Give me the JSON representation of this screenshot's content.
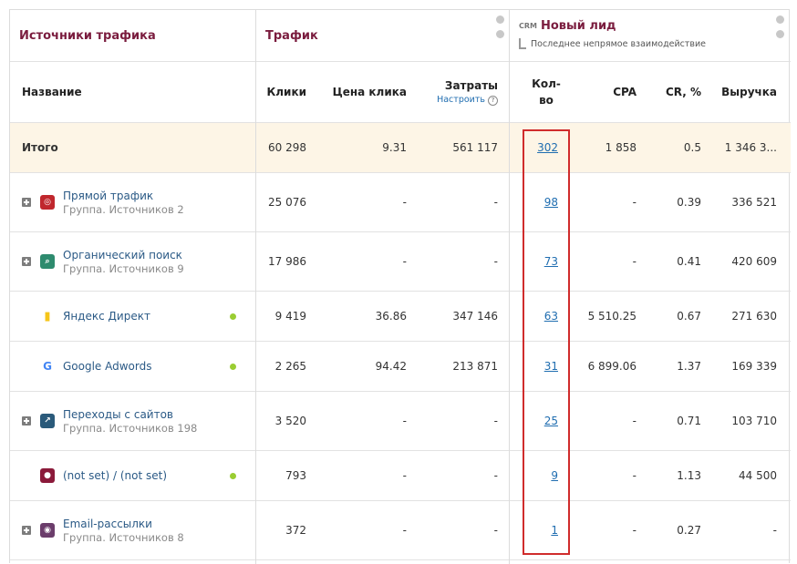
{
  "header": {
    "sources_title": "Источники трафика",
    "traffic_title": "Трафик",
    "crm_badge": "CRM",
    "lead_title": "Новый лид",
    "lead_subtitle": "Последнее непрямое взаимодействие"
  },
  "columns": {
    "name": "Название",
    "clicks": "Клики",
    "click_price": "Цена клика",
    "costs": "Затраты",
    "costs_setup": "Настроить",
    "qty_line1": "Кол-",
    "qty_line2": "во",
    "cpa": "CPA",
    "cr": "CR, %",
    "revenue": "Выручка"
  },
  "total": {
    "label": "Итого",
    "clicks": "60 298",
    "price": "9.31",
    "costs": "561 117",
    "qty": "302",
    "cpa": "1 858",
    "cr": "0.5",
    "revenue": "1 346 3..."
  },
  "rows": [
    {
      "name": "Прямой трафик",
      "sub": "Группа. Источников 2",
      "clicks": "25 076",
      "price": "-",
      "costs": "-",
      "qty": "98",
      "cpa": "-",
      "cr": "0.39",
      "revenue": "336 521",
      "icon": "direct-traffic-icon",
      "color": "#c0272d"
    },
    {
      "name": "Органический поиск",
      "sub": "Группа. Источников 9",
      "clicks": "17 986",
      "price": "-",
      "costs": "-",
      "qty": "73",
      "cpa": "-",
      "cr": "0.41",
      "revenue": "420 609",
      "icon": "search-icon",
      "color": "#2e8b6e"
    },
    {
      "name": "Яндекс Директ",
      "sub": "",
      "clicks": "9 419",
      "price": "36.86",
      "costs": "347 146",
      "qty": "63",
      "cpa": "5 510.25",
      "cr": "0.67",
      "revenue": "271 630",
      "icon": "yandex-direct-icon",
      "color": "#f5c518"
    },
    {
      "name": "Google Adwords",
      "sub": "",
      "clicks": "2 265",
      "price": "94.42",
      "costs": "213 871",
      "qty": "31",
      "cpa": "6 899.06",
      "cr": "1.37",
      "revenue": "169 339",
      "icon": "google-icon",
      "color": "#4285f4"
    },
    {
      "name": "Переходы с сайтов",
      "sub": "Группа. Источников 198",
      "clicks": "3 520",
      "price": "-",
      "costs": "-",
      "qty": "25",
      "cpa": "-",
      "cr": "0.71",
      "revenue": "103 710",
      "icon": "link-icon",
      "color": "#2a5a7a"
    },
    {
      "name": "(not set) / (not set)",
      "sub": "",
      "clicks": "793",
      "price": "-",
      "costs": "-",
      "qty": "9",
      "cpa": "-",
      "cr": "1.13",
      "revenue": "44 500",
      "icon": "not-set-icon",
      "color": "#8b1a3a"
    },
    {
      "name": "Email-рассылки",
      "sub": "Группа. Источников 8",
      "clicks": "372",
      "price": "-",
      "costs": "-",
      "qty": "1",
      "cpa": "-",
      "cr": "0.27",
      "revenue": "-",
      "icon": "email-icon",
      "color": "#6b3d6b"
    }
  ]
}
